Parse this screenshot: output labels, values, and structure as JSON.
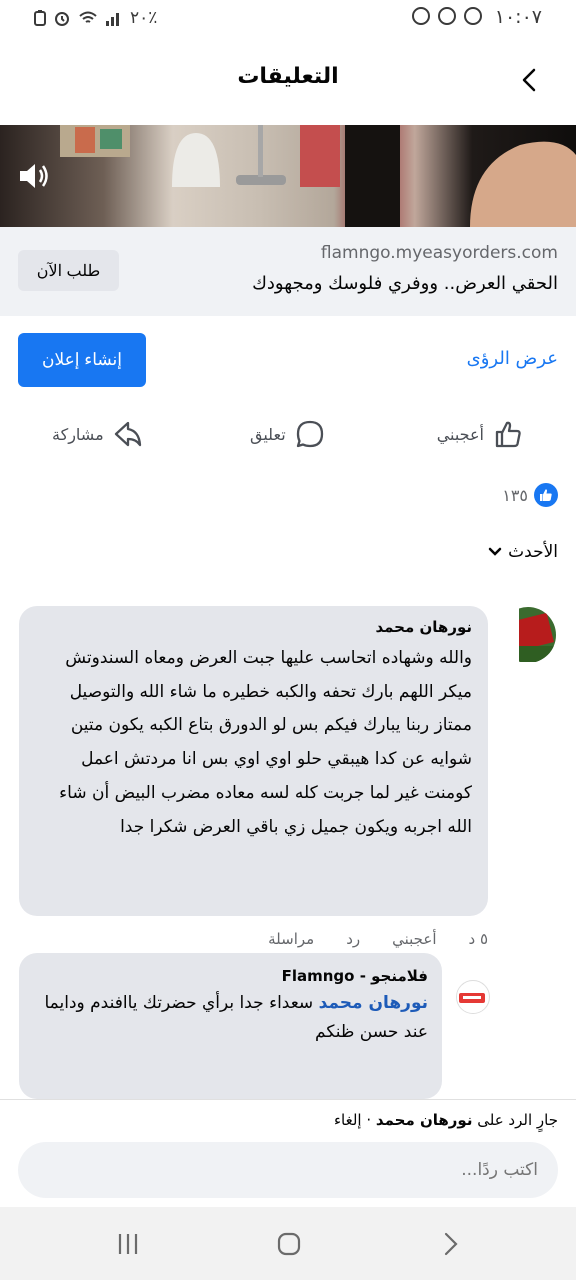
{
  "status_bar": {
    "time": "١٠:٠٧",
    "battery": "٢٠٪"
  },
  "header": {
    "title": "التعليقات"
  },
  "link_preview": {
    "domain": "flamngo.myeasyorders.com",
    "headline": "الحقي العرض.. ووفري فلوسك ومجهودك",
    "order_button": "طلب الآن"
  },
  "promo": {
    "create_ad": "إنشاء إعلان",
    "insights": "عرض الرؤى"
  },
  "actions": {
    "like": "أعجبني",
    "comment": "تعليق",
    "share": "مشاركة"
  },
  "reactions": {
    "count": "١٣٥"
  },
  "sort": {
    "label": "الأحدث"
  },
  "comments": [
    {
      "author": "نورهان محمد",
      "body": "والله وشهاده اتحاسب عليها جبت العرض ومعاه السندوتش ميكر اللهم بارك تحفه والكبه خطيره ما شاء الله والتوصيل ممتاز ربنا يبارك فيكم بس لو الدورق بتاع الكبه يكون متين شوايه عن كدا هيبقي حلو اوي اوي بس انا مردتش اعمل كومنت غير لما جربت كله لسه معاده مضرب البيض أن شاء الله اجربه ويكون جميل زي باقي العرض شكرا جدا",
      "time": "٥ د",
      "like": "أعجبني",
      "reply": "رد",
      "message": "مراسلة"
    },
    {
      "author": "فلامنجو - Flamngo",
      "mention": "نورهان محمد",
      "body": "سعداء جدا برأي حضرتك ياافندم ودايما عند حسن ظنكم"
    }
  ],
  "reply_bar": {
    "prefix": "جارٍ الرد على",
    "name": "نورهان محمد",
    "separator": "·",
    "cancel": "إلغاء",
    "placeholder": "اكتب ردًا..."
  },
  "colors": {
    "accent": "#1877f2",
    "bubble": "#e4e6eb",
    "muted": "#65676b",
    "mention": "#1d5bb8"
  },
  "icons": [
    "back-arrow-icon",
    "speaker-icon",
    "thumb-up-icon",
    "comment-bubble-icon",
    "share-arrow-icon",
    "chevron-down-icon",
    "recent-apps-icon",
    "home-icon",
    "nav-back-icon"
  ]
}
